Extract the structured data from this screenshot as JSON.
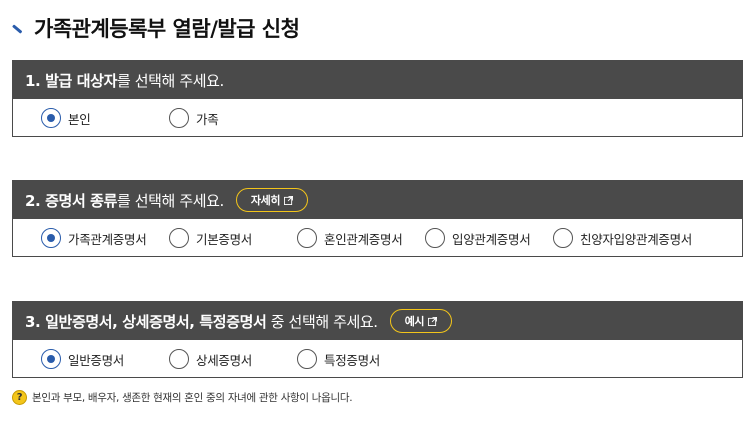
{
  "page": {
    "title": "가족관계등록부 열람/발급 신청"
  },
  "section1": {
    "title_strong": "1. 발급 대상자",
    "title_rest": "를 선택해 주세요.",
    "options": [
      {
        "label": "본인",
        "checked": true
      },
      {
        "label": "가족",
        "checked": false
      }
    ]
  },
  "section2": {
    "title_strong": "2. 증명서 종류",
    "title_rest": "를 선택해 주세요.",
    "button_label": "자세히",
    "options": [
      {
        "label": "가족관계증명서",
        "checked": true
      },
      {
        "label": "기본증명서",
        "checked": false
      },
      {
        "label": "혼인관계증명서",
        "checked": false
      },
      {
        "label": "입양관계증명서",
        "checked": false
      },
      {
        "label": "친양자입양관계증명서",
        "checked": false
      }
    ]
  },
  "section3": {
    "title_strong": "3. 일반증명서, 상세증명서, 특정증명서",
    "title_rest": " 중 선택해 주세요.",
    "button_label": "예시",
    "options": [
      {
        "label": "일반증명서",
        "checked": true
      },
      {
        "label": "상세증명서",
        "checked": false
      },
      {
        "label": "특정증명서",
        "checked": false
      }
    ]
  },
  "note": {
    "icon": "?",
    "text": "본인과 부모, 배우자, 생존한 현재의 혼인 중의 자녀에 관한 사항이 나옵니다."
  },
  "colors": {
    "header_bg": "#4a4a4a",
    "accent_blue": "#2a5cab",
    "accent_yellow": "#f3c51a"
  }
}
